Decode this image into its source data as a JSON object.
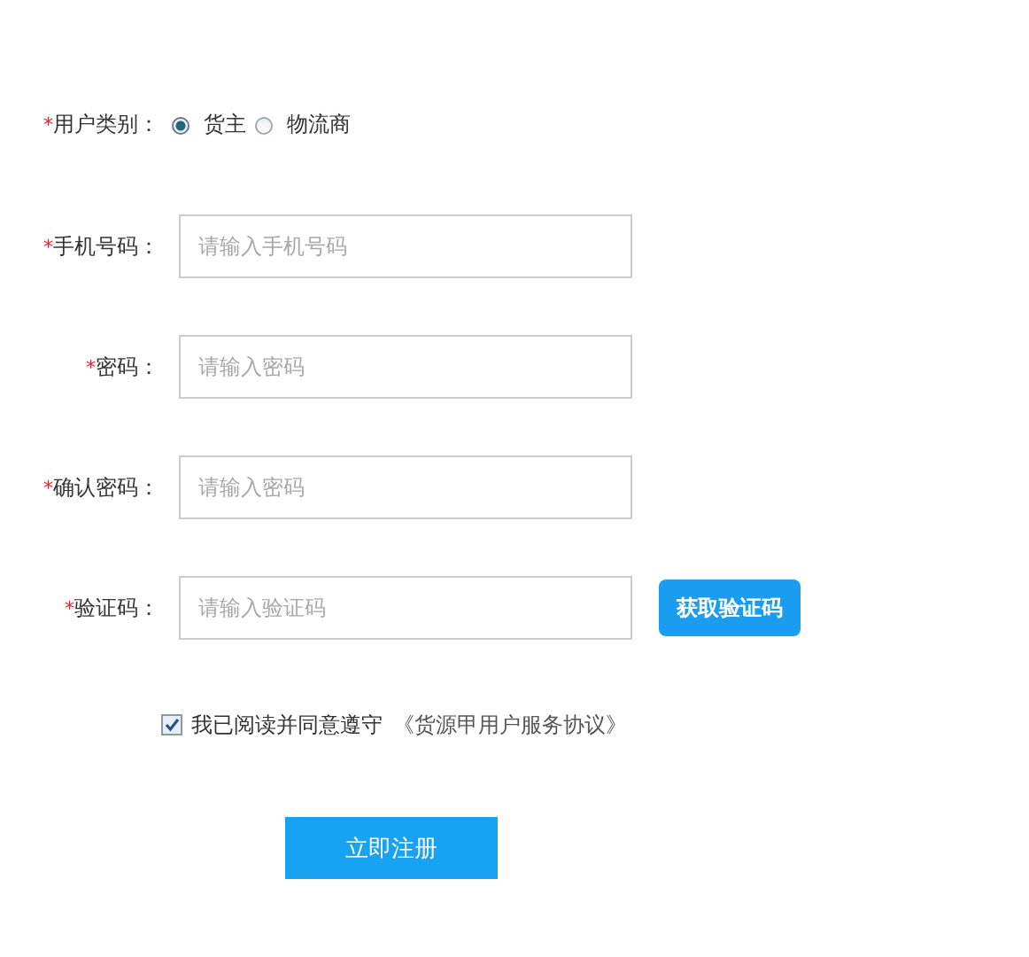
{
  "user_type": {
    "required_mark": "*",
    "label": "用户类别：",
    "options": [
      {
        "label": "货主",
        "selected": true
      },
      {
        "label": "物流商",
        "selected": false
      }
    ]
  },
  "fields": [
    {
      "required_mark": "*",
      "label": "手机号码：",
      "placeholder": "请输入手机号码"
    },
    {
      "required_mark": "*",
      "label": "密码：",
      "placeholder": "请输入密码"
    },
    {
      "required_mark": "*",
      "label": "确认密码：",
      "placeholder": "请输入密码"
    },
    {
      "required_mark": "*",
      "label": "验证码：",
      "placeholder": "请输入验证码",
      "action_button": "获取验证码"
    }
  ],
  "agreement": {
    "checked": true,
    "text": "我已阅读并同意遵守",
    "link": "《货源甲用户服务协议》"
  },
  "submit_button": "立即注册"
}
